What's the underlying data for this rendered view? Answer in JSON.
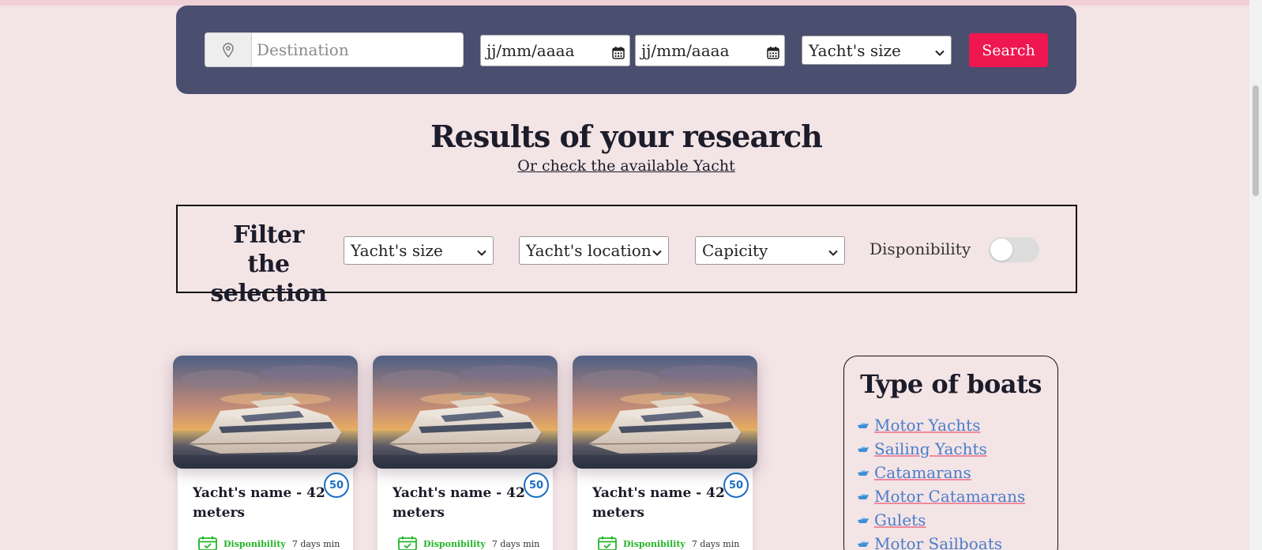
{
  "search": {
    "destination_placeholder": "Destination",
    "date_from": "jj/mm/aaaa",
    "date_to": "jj/mm/aaaa",
    "size_select": "Yacht's size",
    "search_button": "Search"
  },
  "results": {
    "title": "Results of your research",
    "link": "Or check the available Yacht"
  },
  "filter": {
    "title": "Filter the selection",
    "size_select": "Yacht's size",
    "location_select": "Yacht's location",
    "capacity_select": "Capicity",
    "disponibility_label": "Disponibility",
    "disponibility_on": false
  },
  "cards": [
    {
      "name": "Yacht's name - 42 meters",
      "badge": "50",
      "dispo": "Disponibility",
      "days": "7 days min"
    },
    {
      "name": "Yacht's name - 42 meters",
      "badge": "50",
      "dispo": "Disponibility",
      "days": "7 days min"
    },
    {
      "name": "Yacht's name - 42 meters",
      "badge": "50",
      "dispo": "Disponibility",
      "days": "7 days min"
    }
  ],
  "types": {
    "title": "Type of boats",
    "items": [
      "Motor Yachts",
      "Sailing Yachts",
      "Catamarans",
      "Motor Catamarans",
      "Gulets",
      "Motor Sailboats"
    ]
  },
  "colors": {
    "search_panel": "#4a4e6f",
    "accent": "#ee1750",
    "background": "#f3e4e6",
    "badge": "#1b6fc1",
    "dispo_green": "#23b527",
    "link_blue": "#4b7dc9"
  },
  "icons": {
    "destination": "map-pin-icon",
    "date": "calendar-icon",
    "card_dispo": "calendar-check-icon",
    "type_item": "boat-icon"
  }
}
